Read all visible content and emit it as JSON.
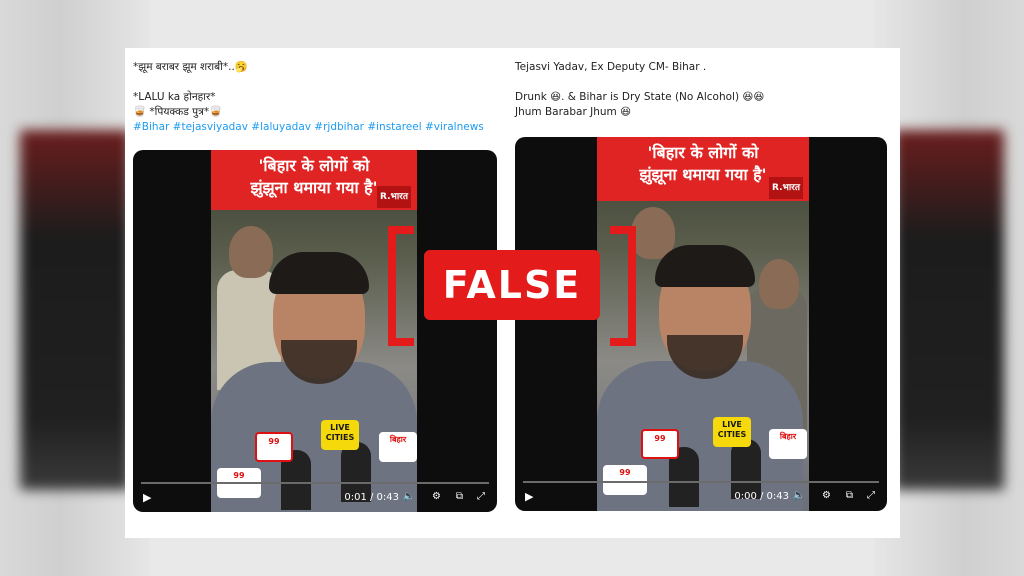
{
  "overlay": {
    "verdict": "FALSE"
  },
  "posts": [
    {
      "caption_lines": [
        "*झूम बराबर झूम शराबी*..🥱",
        "",
        "*LALU ka होनहार*",
        "🥃 *पियक्कड पुत्र*🥃"
      ],
      "hashtags": "#Bihar #tejasviyadav #laluyadav #rjdbihar #instareel #viralnews",
      "banner": "'बिहार के लोगों को\nझुंझूना थमाया गया है'",
      "brand": "R.भारत",
      "mics": [
        "99",
        "LIVE CITIES",
        "बिहार",
        "99"
      ],
      "time": "0:01 / 0:43"
    },
    {
      "caption_lines": [
        "Tejasvi Yadav, Ex Deputy CM- Bihar .",
        "",
        "Drunk 😆. & Bihar is Dry State (No Alcohol) 😆😆",
        "Jhum Barabar Jhum 😆"
      ],
      "hashtags": "",
      "banner": "'बिहार के लोगों को\nझुंझूना थमाया गया है'",
      "brand": "R.भारत",
      "mics": [
        "99",
        "LIVE CITIES",
        "बिहार",
        "99"
      ],
      "time": "0:00 / 0:43"
    }
  ],
  "icons": [
    "play-icon",
    "volume-icon",
    "settings-icon",
    "pip-icon",
    "fullscreen-icon"
  ],
  "colors": {
    "banner_red": "#e02424",
    "stamp_red": "#e31b1b",
    "hashtag_blue": "#1d9bf0"
  }
}
